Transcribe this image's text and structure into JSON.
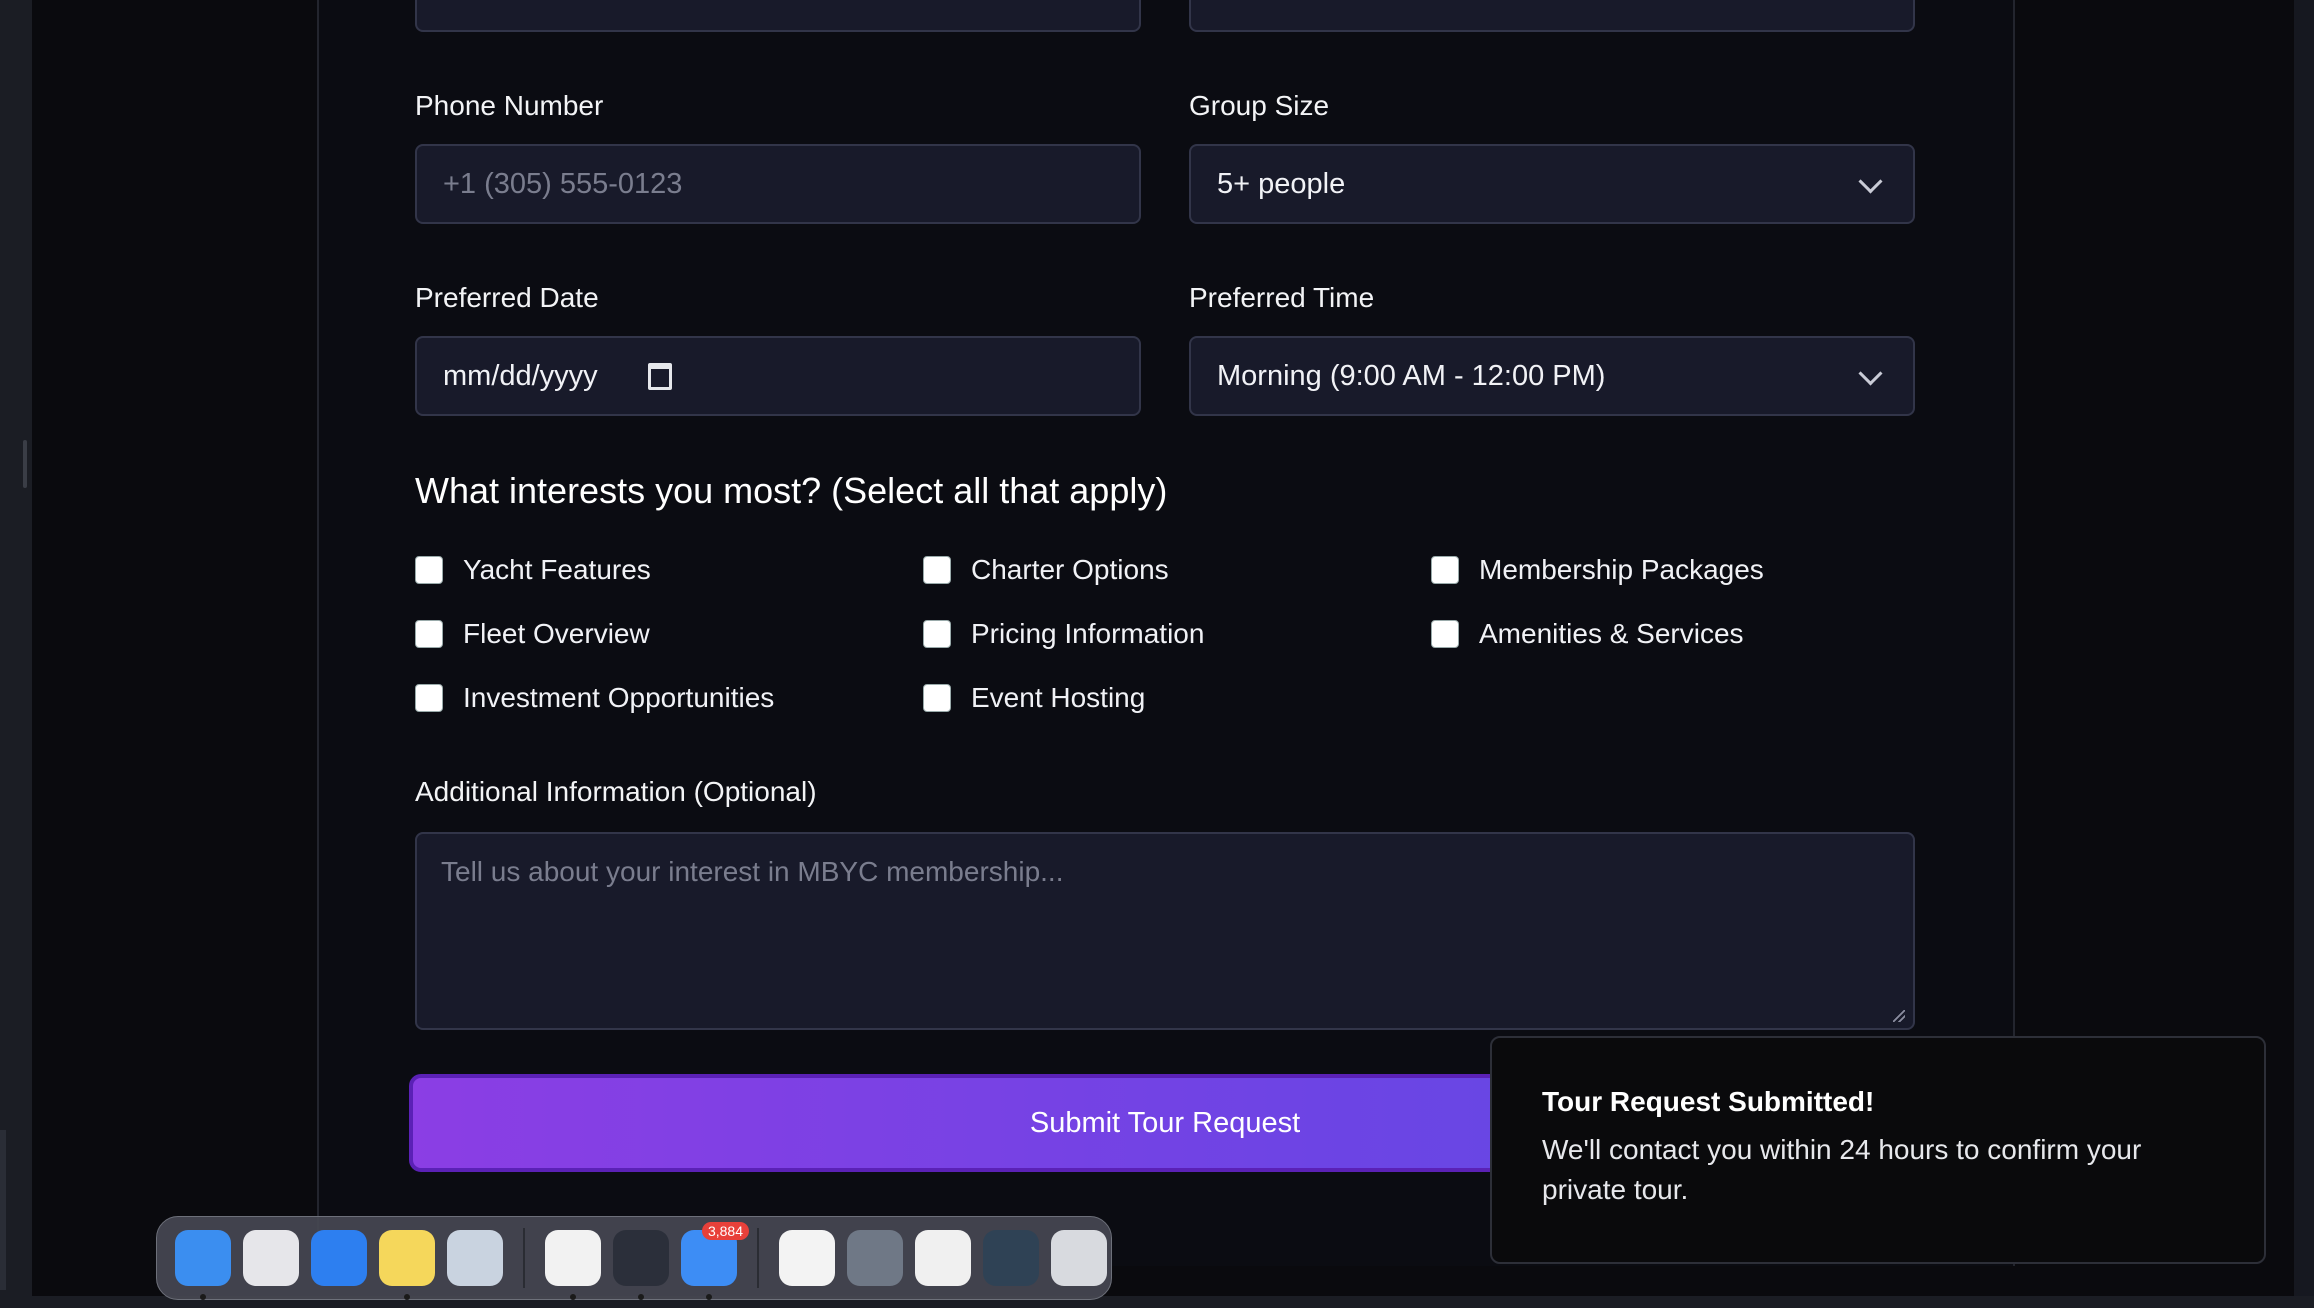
{
  "form": {
    "phone": {
      "label": "Phone Number",
      "placeholder": "+1 (305) 555-0123"
    },
    "group_size": {
      "label": "Group Size",
      "value": "5+ people"
    },
    "date": {
      "label": "Preferred Date",
      "value": "mm/dd/yyyy"
    },
    "time": {
      "label": "Preferred Time",
      "value": "Morning (9:00 AM - 12:00 PM)"
    },
    "interests_title": "What interests you most? (Select all that apply)",
    "interests": [
      {
        "label": "Yacht Features",
        "checked": false
      },
      {
        "label": "Charter Options",
        "checked": false
      },
      {
        "label": "Membership Packages",
        "checked": false
      },
      {
        "label": "Fleet Overview",
        "checked": false
      },
      {
        "label": "Pricing Information",
        "checked": false
      },
      {
        "label": "Amenities & Services",
        "checked": false
      },
      {
        "label": "Investment Opportunities",
        "checked": false
      },
      {
        "label": "Event Hosting",
        "checked": false
      }
    ],
    "additional": {
      "label": "Additional Information (Optional)",
      "placeholder": "Tell us about your interest in MBYC membership..."
    },
    "submit_label": "Submit Tour Request"
  },
  "toast": {
    "title": "Tour Request Submitted!",
    "message": "We'll contact you within 24 hours to confirm your private tour."
  },
  "dock": {
    "apps": [
      {
        "name": "finder-icon",
        "color": "#3b8ef0"
      },
      {
        "name": "launchpad-icon",
        "color": "#e6e6ea"
      },
      {
        "name": "safari-icon",
        "color": "#2d7ff0"
      },
      {
        "name": "notes-icon",
        "color": "#f5d75b"
      },
      {
        "name": "preview-icon",
        "color": "#c9d3e0"
      },
      {
        "name": "chrome-icon",
        "color": "#f2f2f2"
      },
      {
        "name": "quicktime-icon",
        "color": "#2b2f3a"
      },
      {
        "name": "mail-icon",
        "color": "#3d8df5"
      },
      {
        "name": "document-icon",
        "color": "#f3f3f3"
      },
      {
        "name": "window-thumbnail-icon",
        "color": "#6f7886"
      },
      {
        "name": "window-thumbnail-icon",
        "color": "#f0f0f0"
      },
      {
        "name": "window-thumbnail-icon",
        "color": "#2f4255"
      },
      {
        "name": "trash-icon",
        "color": "#d8dadf"
      }
    ],
    "mail_badge": "3,884"
  }
}
